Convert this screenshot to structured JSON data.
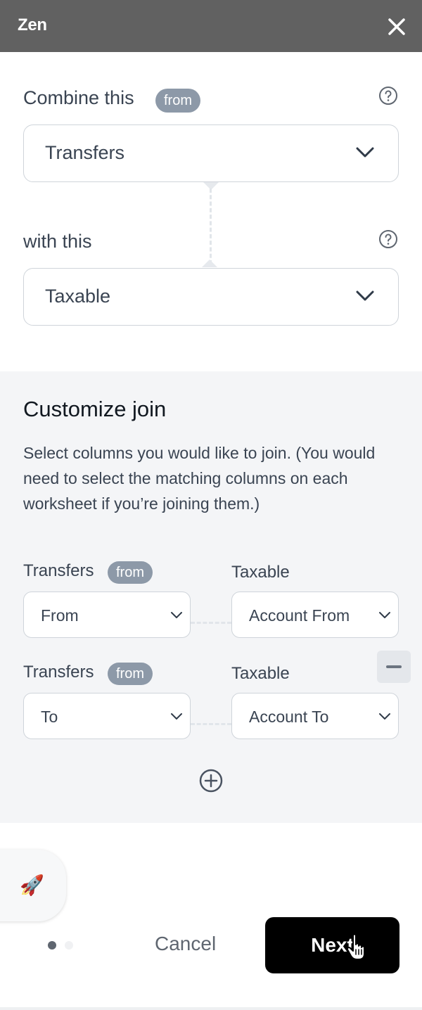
{
  "window": {
    "title": "Zen"
  },
  "combine": {
    "label": "Combine this",
    "badge": "from",
    "selected": "Transfers"
  },
  "with": {
    "label": "with this",
    "selected": "Taxable"
  },
  "customize": {
    "title": "Customize join",
    "description": "Select columns you would like to join. (You would need to select the matching columns on each worksheet if you’re joining them.)",
    "rows": [
      {
        "left_label": "Transfers",
        "left_badge": "from",
        "left_value": "From",
        "right_label": "Taxable",
        "right_value": "Account From"
      },
      {
        "left_label": "Transfers",
        "left_badge": "from",
        "left_value": "To",
        "right_label": "Taxable",
        "right_value": "Account To"
      }
    ]
  },
  "footer": {
    "cancel": "Cancel",
    "next": "Next",
    "pagination": {
      "current": 1,
      "total": 2
    }
  },
  "icons": {
    "close": "close-icon",
    "help": "help-circle-icon",
    "chevron": "chevron-down-icon",
    "add": "plus-circle-icon",
    "remove": "minus-icon",
    "rocket": "rocket-icon",
    "cursor": "hand-pointer-icon"
  },
  "colors": {
    "titlebar": "#616161",
    "badge": "#8d99a8",
    "panel": "#f4f5f7",
    "primary_button": "#000000"
  }
}
